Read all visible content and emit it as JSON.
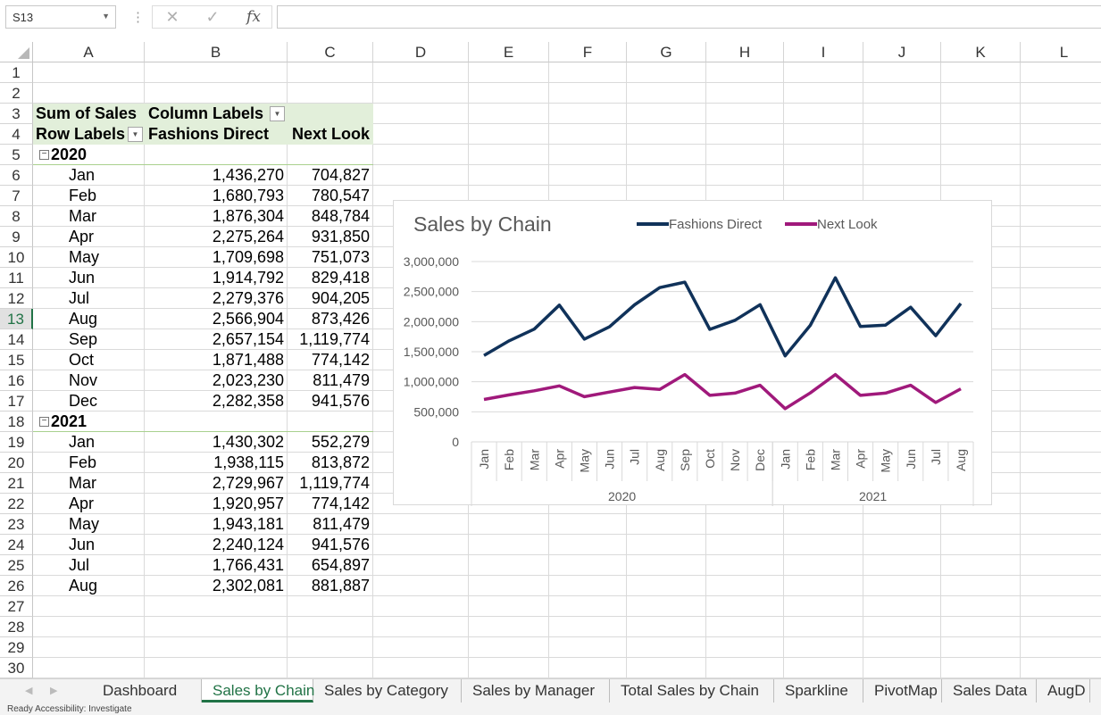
{
  "namebox": {
    "value": "S13"
  },
  "formula_bar": {
    "cancel_icon": "x-icon",
    "enter_icon": "check-icon",
    "fx_label": "fx",
    "value": ""
  },
  "columns": [
    "A",
    "B",
    "C",
    "D",
    "E",
    "F",
    "G",
    "H",
    "I",
    "J",
    "K",
    "L"
  ],
  "rows": [
    "1",
    "2",
    "3",
    "4",
    "5",
    "6",
    "7",
    "8",
    "9",
    "10",
    "11",
    "12",
    "13",
    "14",
    "15",
    "16",
    "17",
    "18",
    "19",
    "20",
    "21",
    "22",
    "23",
    "24",
    "25",
    "26",
    "27",
    "28",
    "29",
    "30"
  ],
  "selected_row": "13",
  "pivot": {
    "sum_label": "Sum of Sales",
    "column_labels": "Column Labels",
    "row_labels": "Row Labels",
    "col1": "Fashions Direct",
    "col2": "Next Look",
    "groups": [
      {
        "year": "2020",
        "rows": [
          {
            "month": "Jan",
            "fd": "1,436,270",
            "nl": "704,827"
          },
          {
            "month": "Feb",
            "fd": "1,680,793",
            "nl": "780,547"
          },
          {
            "month": "Mar",
            "fd": "1,876,304",
            "nl": "848,784"
          },
          {
            "month": "Apr",
            "fd": "2,275,264",
            "nl": "931,850"
          },
          {
            "month": "May",
            "fd": "1,709,698",
            "nl": "751,073"
          },
          {
            "month": "Jun",
            "fd": "1,914,792",
            "nl": "829,418"
          },
          {
            "month": "Jul",
            "fd": "2,279,376",
            "nl": "904,205"
          },
          {
            "month": "Aug",
            "fd": "2,566,904",
            "nl": "873,426"
          },
          {
            "month": "Sep",
            "fd": "2,657,154",
            "nl": "1,119,774"
          },
          {
            "month": "Oct",
            "fd": "1,871,488",
            "nl": "774,142"
          },
          {
            "month": "Nov",
            "fd": "2,023,230",
            "nl": "811,479"
          },
          {
            "month": "Dec",
            "fd": "2,282,358",
            "nl": "941,576"
          }
        ]
      },
      {
        "year": "2021",
        "rows": [
          {
            "month": "Jan",
            "fd": "1,430,302",
            "nl": "552,279"
          },
          {
            "month": "Feb",
            "fd": "1,938,115",
            "nl": "813,872"
          },
          {
            "month": "Mar",
            "fd": "2,729,967",
            "nl": "1,119,774"
          },
          {
            "month": "Apr",
            "fd": "1,920,957",
            "nl": "774,142"
          },
          {
            "month": "May",
            "fd": "1,943,181",
            "nl": "811,479"
          },
          {
            "month": "Jun",
            "fd": "2,240,124",
            "nl": "941,576"
          },
          {
            "month": "Jul",
            "fd": "1,766,431",
            "nl": "654,897"
          },
          {
            "month": "Aug",
            "fd": "2,302,081",
            "nl": "881,887"
          }
        ]
      }
    ]
  },
  "chart_data": {
    "type": "line",
    "title": "Sales by Chain",
    "legend_position": "top",
    "categories": [
      "Jan",
      "Feb",
      "Mar",
      "Apr",
      "May",
      "Jun",
      "Jul",
      "Aug",
      "Sep",
      "Oct",
      "Nov",
      "Dec",
      "Jan",
      "Feb",
      "Mar",
      "Apr",
      "May",
      "Jun",
      "Jul",
      "Aug"
    ],
    "category_groups": [
      {
        "label": "2020",
        "count": 12
      },
      {
        "label": "2021",
        "count": 8
      }
    ],
    "y_ticks": [
      "0",
      "500,000",
      "1,000,000",
      "1,500,000",
      "2,000,000",
      "2,500,000",
      "3,000,000"
    ],
    "ylim": [
      0,
      3000000
    ],
    "grid": true,
    "series": [
      {
        "name": "Fashions Direct",
        "color": "#10325a",
        "values": [
          1436270,
          1680793,
          1876304,
          2275264,
          1709698,
          1914792,
          2279376,
          2566904,
          2657154,
          1871488,
          2023230,
          2282358,
          1430302,
          1938115,
          2729967,
          1920957,
          1943181,
          2240124,
          1766431,
          2302081
        ]
      },
      {
        "name": "Next Look",
        "color": "#a0197b",
        "values": [
          704827,
          780547,
          848784,
          931850,
          751073,
          829418,
          904205,
          873426,
          1119774,
          774142,
          811479,
          941576,
          552279,
          813872,
          1119774,
          774142,
          811479,
          941576,
          654897,
          881887
        ]
      }
    ]
  },
  "tabs": [
    "Dashboard",
    "Sales by Chain",
    "Sales by Category",
    "Sales by Manager",
    "Total Sales by Chain",
    "Sparkline",
    "PivotMap",
    "Sales Data",
    "AugD"
  ],
  "active_tab": "Sales by Chain",
  "status_text": "Ready   Accessibility: Investigate"
}
